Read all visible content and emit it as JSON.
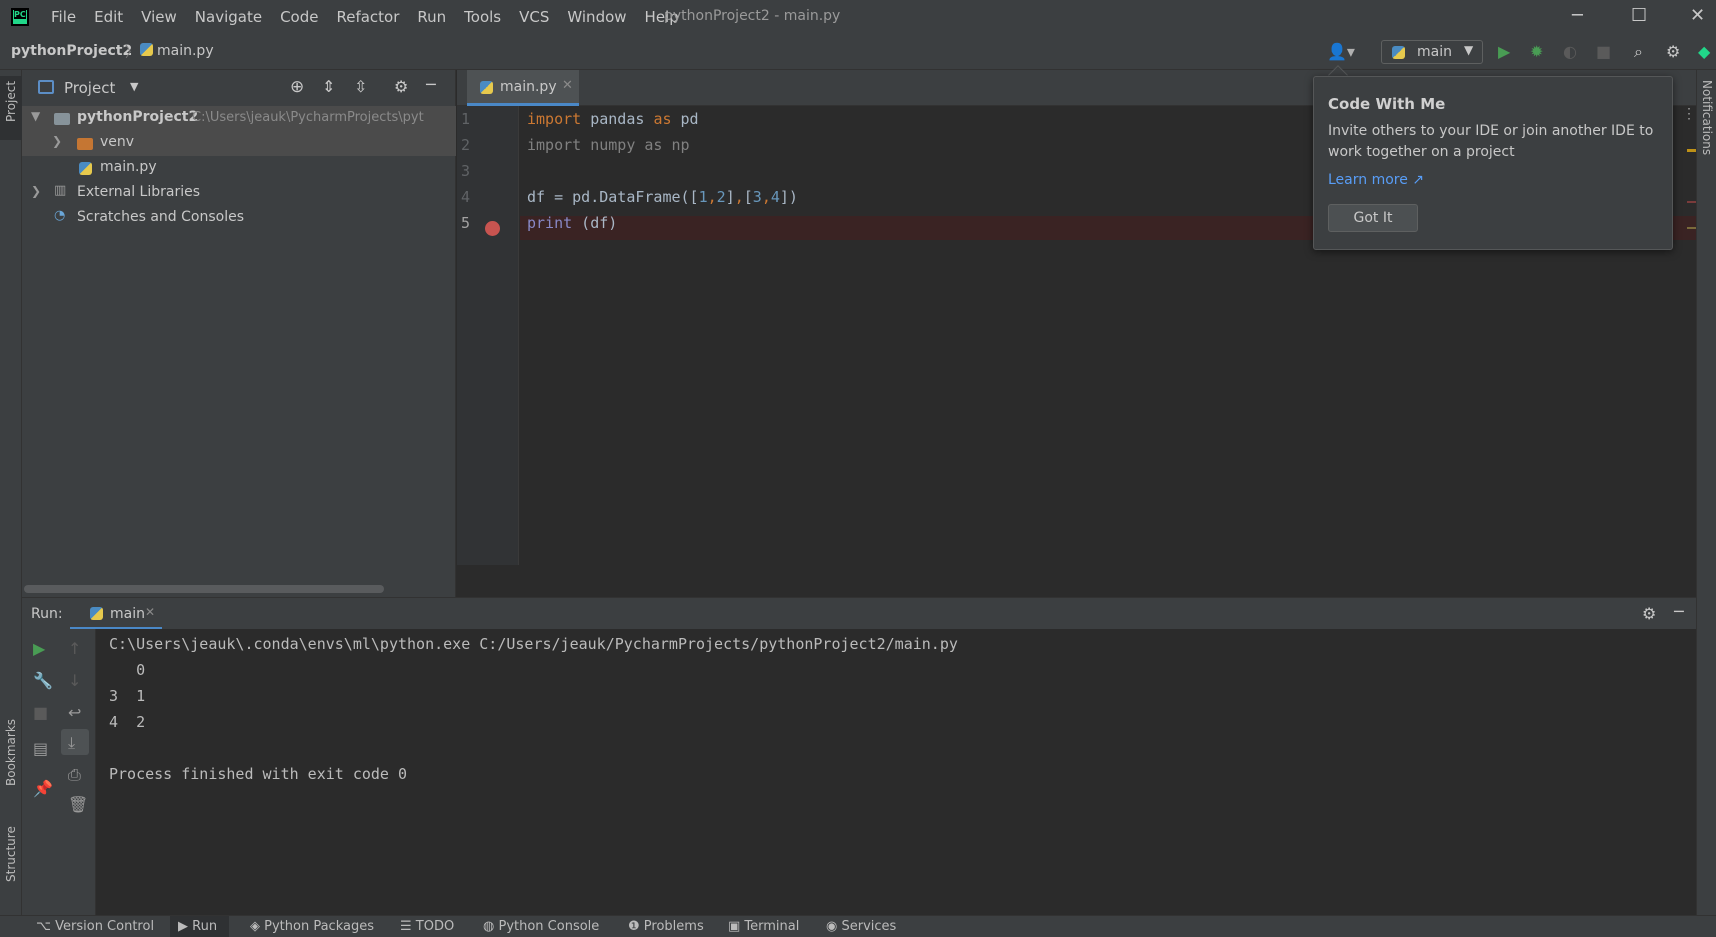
{
  "window": {
    "title": "pythonProject2 - main.py",
    "menu": [
      "File",
      "Edit",
      "View",
      "Navigate",
      "Code",
      "Refactor",
      "Run",
      "Tools",
      "VCS",
      "Window",
      "Help"
    ]
  },
  "navbar": {
    "project": "pythonProject2",
    "file": "main.py",
    "run_config": "main"
  },
  "left_strip": {
    "project_label": "Project",
    "bookmarks_label": "Bookmarks",
    "structure_label": "Structure"
  },
  "right_strip": {
    "notifications_label": "Notifications"
  },
  "project_panel": {
    "title": "Project",
    "tree": [
      {
        "label": "pythonProject2",
        "path": "C:\\Users\\jeauk\\PycharmProjects\\pyt"
      },
      {
        "label": "venv"
      },
      {
        "label": "main.py"
      },
      {
        "label": "External Libraries"
      },
      {
        "label": "Scratches and Consoles"
      }
    ]
  },
  "editor": {
    "tab": "main.py",
    "line_numbers": [
      "1",
      "2",
      "3",
      "4",
      "5"
    ]
  },
  "popup": {
    "title": "Code With Me",
    "body": "Invite others to your IDE or join another IDE to work together on a project",
    "link": "Learn more ↗",
    "button": "Got It"
  },
  "run_panel": {
    "label": "Run:",
    "tab": "main",
    "console": [
      "C:\\Users\\jeauk\\.conda\\envs\\ml\\python.exe C:/Users/jeauk/PycharmProjects/pythonProject2/main.py",
      "   0",
      "3  1",
      "4  2",
      "",
      "Process finished with exit code 0"
    ]
  },
  "bottom_bar": {
    "items": [
      "Version Control",
      "Run",
      "Python Packages",
      "TODO",
      "Python Console",
      "Problems",
      "Terminal",
      "Services"
    ]
  }
}
